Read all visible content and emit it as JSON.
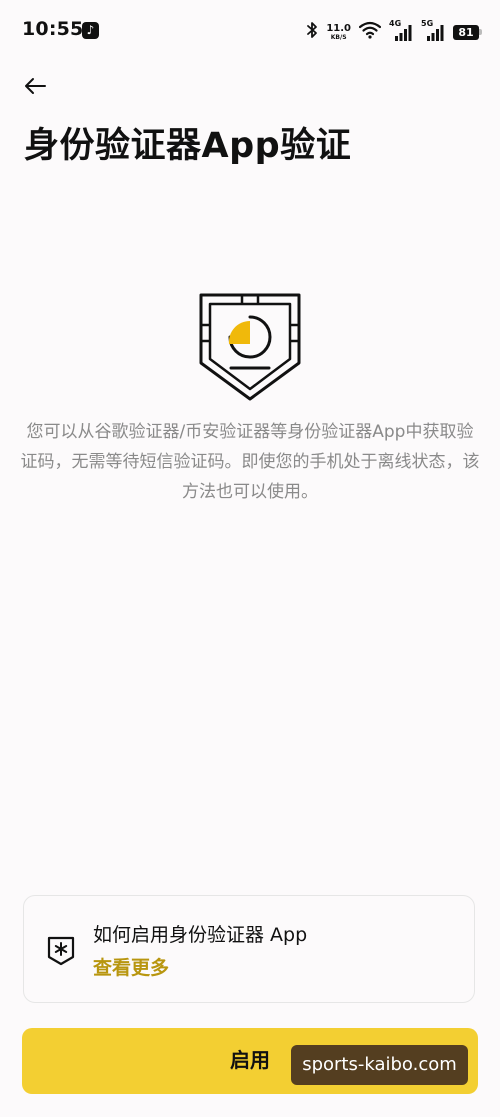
{
  "status_bar": {
    "time": "10:55",
    "net_speed_value": "11.0",
    "net_speed_unit": "KB/S",
    "signal1_tag": "4G",
    "signal2_tag": "5G",
    "battery": "81"
  },
  "header": {
    "title": "身份验证器App验证"
  },
  "main": {
    "description": "您可以从谷歌验证器/币安验证器等身份验证器App中获取验证码，无需等待短信验证码。即使您的手机处于离线状态，该方法也可以使用。"
  },
  "help_card": {
    "title": "如何启用身份验证器 App",
    "link": "查看更多"
  },
  "footer": {
    "enable_label": "启用"
  },
  "watermark": "sports-kaibo.com",
  "colors": {
    "accent": "#F3CF32",
    "link": "#B8960F",
    "illustration_accent": "#F0B90B"
  }
}
